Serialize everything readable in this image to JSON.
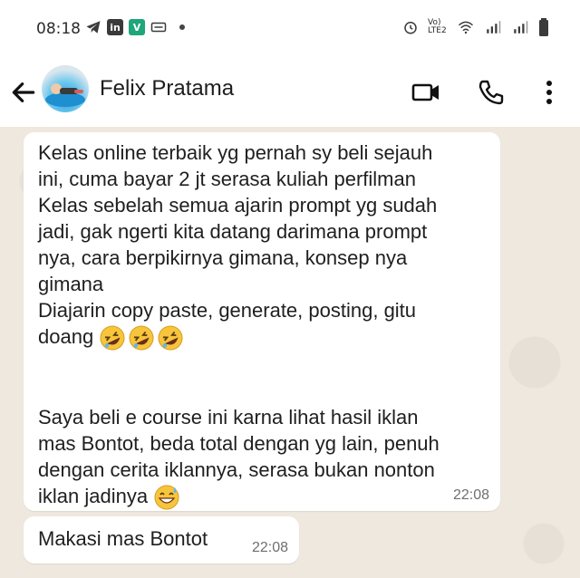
{
  "status_bar": {
    "time": "08:18",
    "left_icons": [
      "telegram-icon",
      "linkedin-icon",
      "vpn-icon",
      "card-icon"
    ],
    "lte_label": "Vo) LTE2"
  },
  "header": {
    "contact_name": "Felix Pratama"
  },
  "messages": [
    {
      "paragraph_1": "Kelas online terbaik yg pernah sy beli sejauh\nini, cuma bayar 2 jt serasa kuliah perfilman\nKelas sebelah semua ajarin prompt yg sudah\njadi, gak ngerti kita datang darimana prompt\nnya, cara berpikirnya gimana, konsep nya\ngimana\nDiajarin copy paste, generate, posting, gitu\ndoang",
      "paragraph_2": "Saya beli e course ini karna lihat hasil iklan\nmas Bontot, beda total dengan yg lain, penuh\ndengan cerita iklannya, serasa bukan nonton\niklan jadinya",
      "emojis_1": [
        "rolling-laughing-emoji",
        "rolling-laughing-emoji",
        "rolling-laughing-emoji"
      ],
      "emojis_2": [
        "grinning-sweat-emoji"
      ],
      "time": "22:08"
    },
    {
      "text": "Makasi mas Bontot",
      "time": "22:08"
    }
  ],
  "colors": {
    "chat_bg": "#efe8de",
    "bubble": "#ffffff",
    "emoji_yellow": "#f7c53b"
  }
}
